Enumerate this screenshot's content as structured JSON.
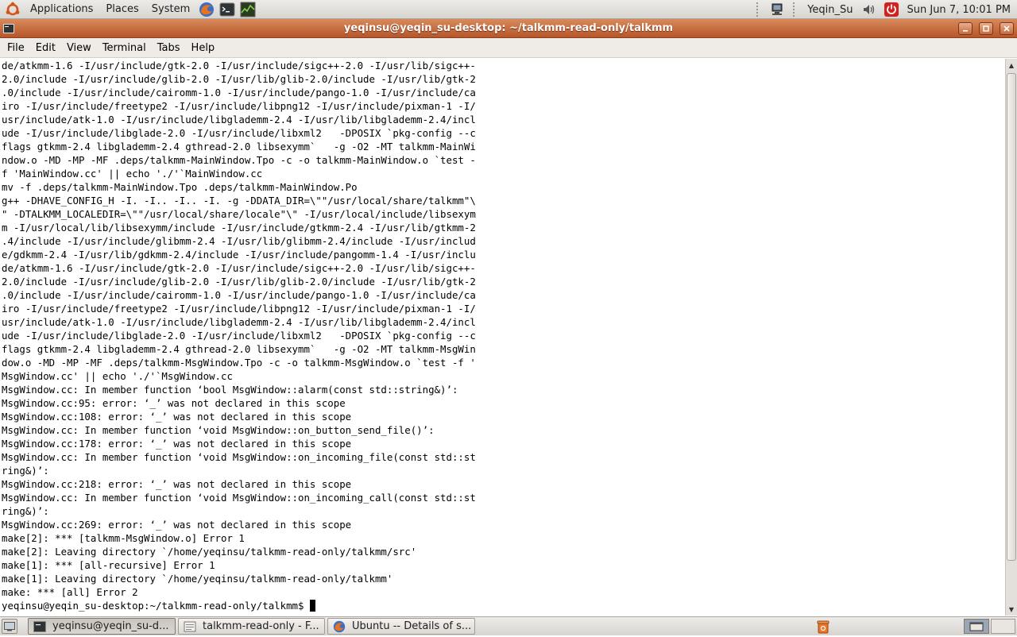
{
  "top_panel": {
    "menus": [
      "Applications",
      "Places",
      "System"
    ],
    "user": "Yeqin_Su",
    "clock": "Sun Jun  7, 10:01 PM",
    "icons": [
      "ubuntu-logo-icon",
      "firefox-icon",
      "terminal-icon",
      "system-monitor-icon",
      "network-icon",
      "volume-icon",
      "power-icon"
    ]
  },
  "window": {
    "title": "yeqinsu@yeqin_su-desktop: ~/talkmm-read-only/talkmm",
    "menu": [
      "File",
      "Edit",
      "View",
      "Terminal",
      "Tabs",
      "Help"
    ]
  },
  "terminal": {
    "lines": [
      "de/atkmm-1.6 -I/usr/include/gtk-2.0 -I/usr/include/sigc++-2.0 -I/usr/lib/sigc++-",
      "2.0/include -I/usr/include/glib-2.0 -I/usr/lib/glib-2.0/include -I/usr/lib/gtk-2",
      ".0/include -I/usr/include/cairomm-1.0 -I/usr/include/pango-1.0 -I/usr/include/ca",
      "iro -I/usr/include/freetype2 -I/usr/include/libpng12 -I/usr/include/pixman-1 -I/",
      "usr/include/atk-1.0 -I/usr/include/libglademm-2.4 -I/usr/lib/libglademm-2.4/incl",
      "ude -I/usr/include/libglade-2.0 -I/usr/include/libxml2   -DPOSIX `pkg-config --c",
      "flags gtkmm-2.4 libglademm-2.4 gthread-2.0 libsexymm`   -g -O2 -MT talkmm-MainWi",
      "ndow.o -MD -MP -MF .deps/talkmm-MainWindow.Tpo -c -o talkmm-MainWindow.o `test -",
      "f 'MainWindow.cc' || echo './'`MainWindow.cc",
      "mv -f .deps/talkmm-MainWindow.Tpo .deps/talkmm-MainWindow.Po",
      "g++ -DHAVE_CONFIG_H -I. -I.. -I.. -I. -g -DDATA_DIR=\\\"\"/usr/local/share/talkmm\"\\",
      "\" -DTALKMM_LOCALEDIR=\\\"\"/usr/local/share/locale\"\\\" -I/usr/local/include/libsexym",
      "m -I/usr/local/lib/libsexymm/include -I/usr/include/gtkmm-2.4 -I/usr/lib/gtkmm-2",
      ".4/include -I/usr/include/glibmm-2.4 -I/usr/lib/glibmm-2.4/include -I/usr/includ",
      "e/gdkmm-2.4 -I/usr/lib/gdkmm-2.4/include -I/usr/include/pangomm-1.4 -I/usr/inclu",
      "de/atkmm-1.6 -I/usr/include/gtk-2.0 -I/usr/include/sigc++-2.0 -I/usr/lib/sigc++-",
      "2.0/include -I/usr/include/glib-2.0 -I/usr/lib/glib-2.0/include -I/usr/lib/gtk-2",
      ".0/include -I/usr/include/cairomm-1.0 -I/usr/include/pango-1.0 -I/usr/include/ca",
      "iro -I/usr/include/freetype2 -I/usr/include/libpng12 -I/usr/include/pixman-1 -I/",
      "usr/include/atk-1.0 -I/usr/include/libglademm-2.4 -I/usr/lib/libglademm-2.4/incl",
      "ude -I/usr/include/libglade-2.0 -I/usr/include/libxml2   -DPOSIX `pkg-config --c",
      "flags gtkmm-2.4 libglademm-2.4 gthread-2.0 libsexymm`   -g -O2 -MT talkmm-MsgWin",
      "dow.o -MD -MP -MF .deps/talkmm-MsgWindow.Tpo -c -o talkmm-MsgWindow.o `test -f '",
      "MsgWindow.cc' || echo './'`MsgWindow.cc",
      "MsgWindow.cc: In member function ‘bool MsgWindow::alarm(const std::string&)’:",
      "MsgWindow.cc:95: error: ‘_’ was not declared in this scope",
      "MsgWindow.cc:108: error: ‘_’ was not declared in this scope",
      "MsgWindow.cc: In member function ‘void MsgWindow::on_button_send_file()’:",
      "MsgWindow.cc:178: error: ‘_’ was not declared in this scope",
      "MsgWindow.cc: In member function ‘void MsgWindow::on_incoming_file(const std::st",
      "ring&)’:",
      "MsgWindow.cc:218: error: ‘_’ was not declared in this scope",
      "MsgWindow.cc: In member function ‘void MsgWindow::on_incoming_call(const std::st",
      "ring&)’:",
      "MsgWindow.cc:269: error: ‘_’ was not declared in this scope",
      "make[2]: *** [talkmm-MsgWindow.o] Error 1",
      "make[2]: Leaving directory `/home/yeqinsu/talkmm-read-only/talkmm/src'",
      "make[1]: *** [all-recursive] Error 1",
      "make[1]: Leaving directory `/home/yeqinsu/talkmm-read-only/talkmm'",
      "make: *** [all] Error 2"
    ],
    "prompt": "yeqinsu@yeqin_su-desktop:~/talkmm-read-only/talkmm$ "
  },
  "taskbar": {
    "items": [
      {
        "label": "yeqinsu@yeqin_su-d...",
        "icon": "terminal-icon",
        "active": true
      },
      {
        "label": "talkmm-read-only - F...",
        "icon": "folder-icon",
        "active": false
      },
      {
        "label": "Ubuntu -- Details of s...",
        "icon": "firefox-icon",
        "active": false
      }
    ]
  },
  "colors": {
    "titlebar": "#c46a3e",
    "panel": "#e2dfdb",
    "terminal_bg": "#ffffff",
    "terminal_fg": "#000000"
  }
}
